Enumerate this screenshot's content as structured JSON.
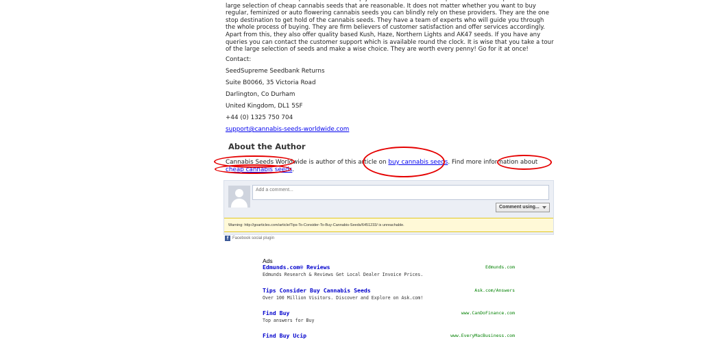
{
  "intro_paragraph": "The above mentioned aspects are sure to help you come across a reliable provider. A reliable provider has a large selection of cheap cannabis seeds that are reasonable. It does not matter whether you want to buy regular, feminized or auto flowering cannabis seeds you can blindly rely on these providers. They are the one stop destination to get hold of the cannabis seeds. They have a team of experts who will guide you through the whole process of buying. They are firm believers of customer satisfaction and offer services accordingly. Apart from this, they also offer quality based Kush, Haze, Northern Lights and AK47 seeds. If you have any queries you can contact the customer support which is available round the clock. It is wise that you take a tour of the large selection of seeds and make a wise choice. They are worth every penny! Go for it at once!",
  "contact": {
    "heading": "Contact:",
    "lines": [
      "SeedSupreme Seedbank Returns",
      "Suite B0066, 35 Victoria Road",
      "Darlington, Co Durham",
      "United Kingdom, DL1 5SF",
      "+44 (0) 1325 750 704"
    ],
    "email": "support@cannabis-seeds-worldwide.com"
  },
  "about": {
    "title": "About the Author",
    "author": "Cannabis Seeds Worldwide",
    "text_mid": " is author of this article on ",
    "link1": "buy cannabis seeds",
    "text_mid2": ". Find more information about ",
    "link2": "cheap cannabis seeds",
    "text_end": "."
  },
  "comments": {
    "placeholder": "Add a comment...",
    "button": "Comment using...",
    "warning": "Warning: http://goarticles.com/article/Tips-To-Consider-To-Buy-Cannabis-Seeds/6451233/ is unreachable.",
    "plugin": "Facebook social plugin",
    "logo_letter": "f"
  },
  "ads": {
    "label": "Ads",
    "items": [
      {
        "title": "Edmunds.com® Reviews",
        "desc": "Edmunds Research & Reviews Get Local Dealer Invoice Prices.",
        "url": "Edmunds.com"
      },
      {
        "title": "Tips Consider Buy Cannabis Seeds",
        "desc": "Over 100 Million Visitors. Discover and Explore on Ask.com!",
        "url": "Ask.com/Answers"
      },
      {
        "title": "Find Buy",
        "desc": "Top answers for Buy",
        "url": "www.CanDoFinance.com"
      },
      {
        "title": "Find Buy Ucip",
        "desc": "",
        "url": "www.EveryMacBusiness.com"
      }
    ]
  },
  "colors": {
    "annotation": "#e50000",
    "link": "#0000ee",
    "ad_title": "#0000cc",
    "ad_url": "#008000"
  }
}
